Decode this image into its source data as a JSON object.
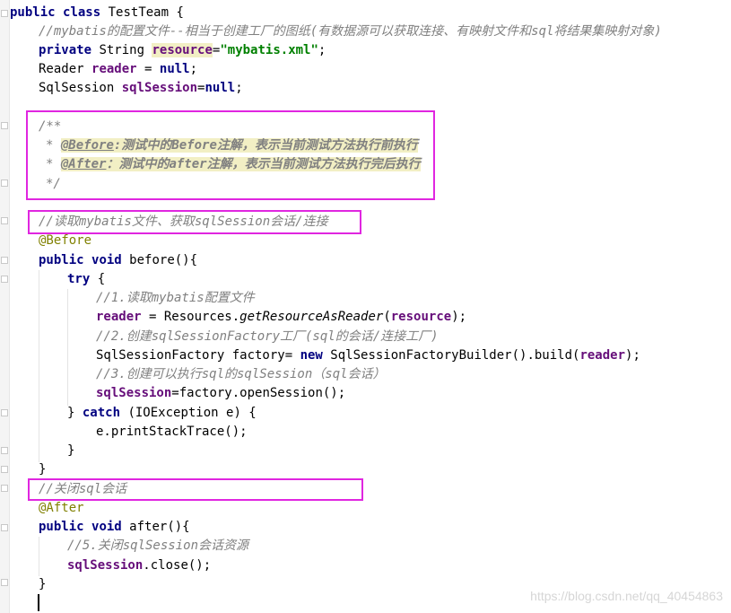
{
  "code": {
    "class_decl": {
      "kw_public": "public",
      "kw_class": "class",
      "name": "TestTeam {"
    },
    "comment_config": "//mybatis的配置文件--相当于创建工厂的图纸(有数据源可以获取连接、有映射文件和sql将结果集映射对象)",
    "resource_decl": {
      "kw_private": "private",
      "type": "String",
      "field": "resource",
      "eq": "=",
      "value": "\"mybatis.xml\"",
      "semi": ";"
    },
    "reader_decl": {
      "type": "Reader",
      "field": "reader",
      "eq": " = ",
      "kw_null": "null",
      "semi": ";"
    },
    "session_decl": {
      "type": "SqlSession",
      "field": "sqlSession",
      "eq": "=",
      "kw_null": "null",
      "semi": ";"
    },
    "javadoc": {
      "open": "/**",
      "star": "*",
      "before_tag": "@Before",
      "before_text": ":测试中的Before注解，表示当前测试方法执行前执行",
      "after_tag": "@After",
      "after_text": "：测试中的after注解，表示当前测试方法执行完后执行",
      "close": "*/"
    },
    "comment_read": "//读取mybatis文件、获取sqlSession会话/连接",
    "annotation_before": "@Before",
    "before_method": {
      "kw_public": "public",
      "kw_void": "void",
      "sig": "before(){"
    },
    "try_line": {
      "kw_try": "try",
      "brace": " {"
    },
    "comment_step1": "//1.读取mybatis配置文件",
    "step1_code": {
      "field": "reader",
      "mid": " = Resources.",
      "method": "getResourceAsReader",
      "open": "(",
      "arg": "resource",
      "close": ");"
    },
    "comment_step2": "//2.创建sqlSessionFactory工厂(sql的会话/连接工厂)",
    "step2_code": {
      "lead": "SqlSessionFactory factory= ",
      "kw_new": "new",
      "mid": " SqlSessionFactoryBuilder().build(",
      "arg": "reader",
      "close": ");"
    },
    "comment_step3": "//3.创建可以执行sql的sqlSession（sql会话）",
    "step3_code": {
      "field": "sqlSession",
      "rest": "=factory.openSession();"
    },
    "catch_line": {
      "brace": "} ",
      "kw_catch": "catch",
      "rest": " (IOException e) {"
    },
    "print_stack": "e.printStackTrace();",
    "close_try": "}",
    "close_method": "}",
    "comment_close": "//关闭sql会话",
    "annotation_after": "@After",
    "after_method": {
      "kw_public": "public",
      "kw_void": "void",
      "sig": "after(){"
    },
    "comment_step5": "//5.关闭sqlSession会话资源",
    "close_call": {
      "field": "sqlSession",
      "rest": ".close();"
    },
    "close_after": "}"
  },
  "watermark": "https://blog.csdn.net/qq_40454863",
  "colors": {
    "keyword": "#000080",
    "field": "#660e7a",
    "string": "#008000",
    "annotation": "#808000",
    "comment": "#808080",
    "highlight_box": "#e026e0",
    "doc_highlight": "#f2efc4"
  }
}
